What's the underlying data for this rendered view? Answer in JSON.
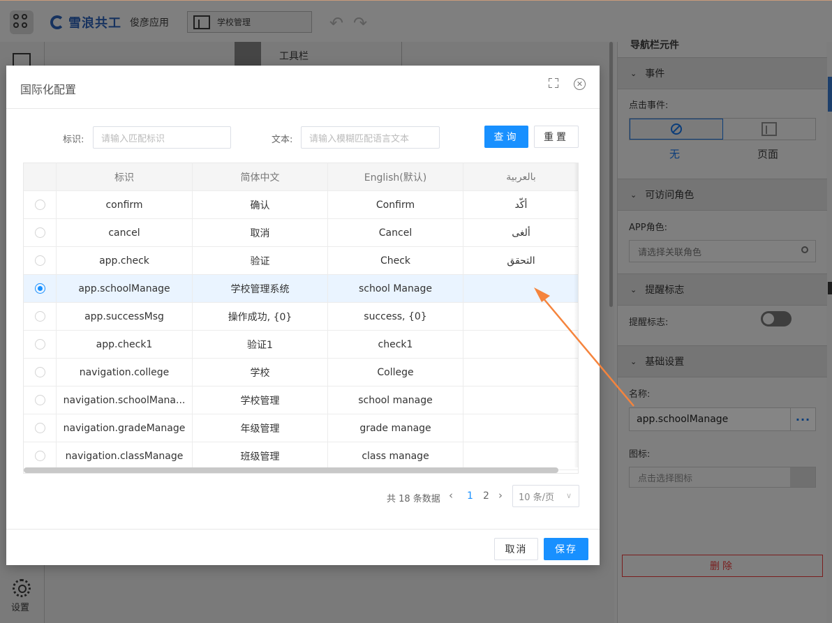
{
  "header": {
    "brand_name": "雪浪共工",
    "brand_sub": "俊彦应用",
    "page_select": "学校管理"
  },
  "leftnav": {
    "settings_label": "设置"
  },
  "canvas": {
    "toolbar_label": "工具栏"
  },
  "right_panel": {
    "cut_title": "导航栏元件",
    "sections": {
      "event": "事件",
      "role": "可访问角色",
      "remind": "提醒标志",
      "basic": "基础设置"
    },
    "click_event_label": "点击事件:",
    "event_none": "无",
    "event_page": "页面",
    "app_role_label": "APP角色:",
    "app_role_placeholder": "请选择关联角色",
    "remind_label": "提醒标志:",
    "name_label": "名称:",
    "name_value": "app.schoolManage",
    "name_more": "···",
    "icon_label": "图标:",
    "icon_placeholder": "点击选择图标",
    "delete_label": "删除"
  },
  "modal": {
    "title": "国际化配置",
    "filter": {
      "key_label": "标识:",
      "key_placeholder": "请输入匹配标识",
      "text_label": "文本:",
      "text_placeholder": "请输入模糊匹配语言文本",
      "query_label": "查询",
      "reset_label": "重置"
    },
    "table": {
      "columns": [
        "",
        "标识",
        "简体中文",
        "English(默认)",
        "بالعربية"
      ],
      "rows": [
        {
          "key": "confirm",
          "zh": "确认",
          "en": "Confirm",
          "ar": "أكّد",
          "selected": false
        },
        {
          "key": "cancel",
          "zh": "取消",
          "en": "Cancel",
          "ar": "ألغى",
          "selected": false
        },
        {
          "key": "app.check",
          "zh": "验证",
          "en": "Check",
          "ar": "التحقق",
          "selected": false
        },
        {
          "key": "app.schoolManage",
          "zh": "学校管理系统",
          "en": "school Manage",
          "ar": "",
          "selected": true
        },
        {
          "key": "app.successMsg",
          "zh": "操作成功, {0}",
          "en": "success, {0}",
          "ar": "",
          "selected": false
        },
        {
          "key": "app.check1",
          "zh": "验证1",
          "en": "check1",
          "ar": "",
          "selected": false
        },
        {
          "key": "navigation.college",
          "zh": "学校",
          "en": "College",
          "ar": "",
          "selected": false
        },
        {
          "key": "navigation.schoolMana...",
          "zh": "学校管理",
          "en": "school manage",
          "ar": "",
          "selected": false
        },
        {
          "key": "navigation.gradeManage",
          "zh": "年级管理",
          "en": "grade manage",
          "ar": "",
          "selected": false
        },
        {
          "key": "navigation.classManage",
          "zh": "班级管理",
          "en": "class manage",
          "ar": "",
          "selected": false
        }
      ]
    },
    "pager": {
      "total_text": "共 18 条数据",
      "pages": [
        "1",
        "2"
      ],
      "current_page": "1",
      "page_size": "10 条/页"
    },
    "footer": {
      "cancel_label": "取消",
      "save_label": "保存"
    }
  },
  "colors": {
    "primary": "#1890ff",
    "annotation_arrow": "#f5843d",
    "selected_row": "#eaf4ff"
  }
}
